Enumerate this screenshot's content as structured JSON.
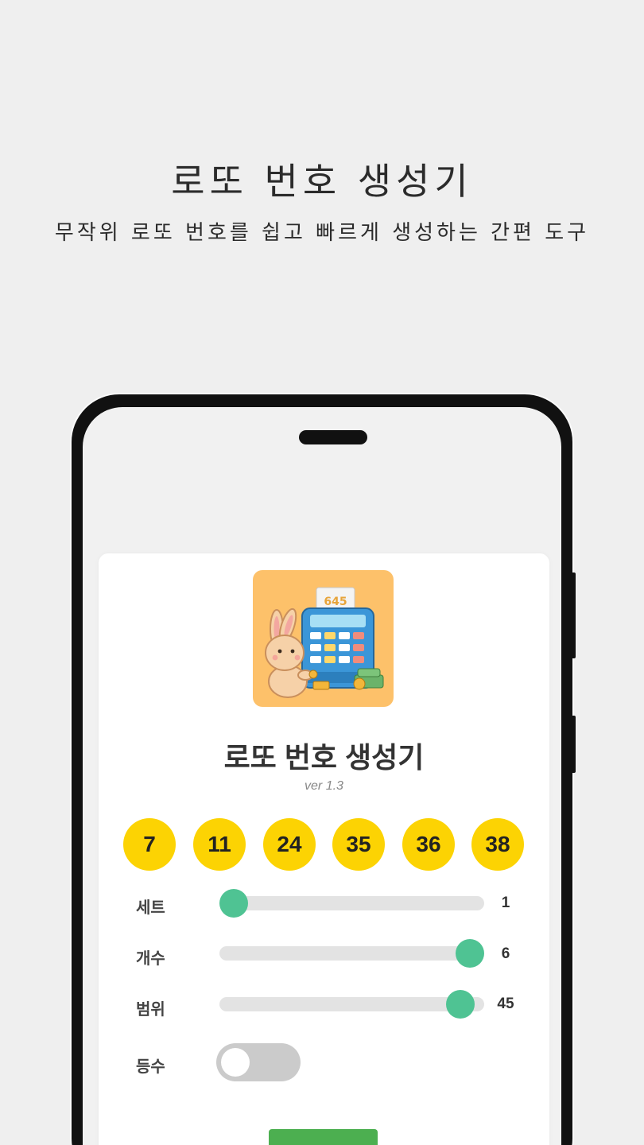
{
  "promo": {
    "title": "로또 번호 생성기",
    "subtitle": "무작위 로또 번호를 쉽고 빠르게 생성하는 간편 도구"
  },
  "app": {
    "title": "로또 번호 생성기",
    "version": "ver 1.3",
    "logo_text": "645",
    "balls": [
      "7",
      "11",
      "24",
      "35",
      "36",
      "38"
    ],
    "settings": [
      {
        "label": "세트",
        "value": "1",
        "fraction": 0.0
      },
      {
        "label": "개수",
        "value": "6",
        "fraction": 1.0
      },
      {
        "label": "범위",
        "value": "45",
        "fraction": 0.96
      }
    ],
    "rank_toggle": {
      "label": "등수",
      "on": false
    },
    "generate_button": ""
  },
  "colors": {
    "ball": "#fcd303",
    "accent": "#4fc393",
    "button": "#4caf50",
    "logo_bg": "#fdc16a"
  }
}
